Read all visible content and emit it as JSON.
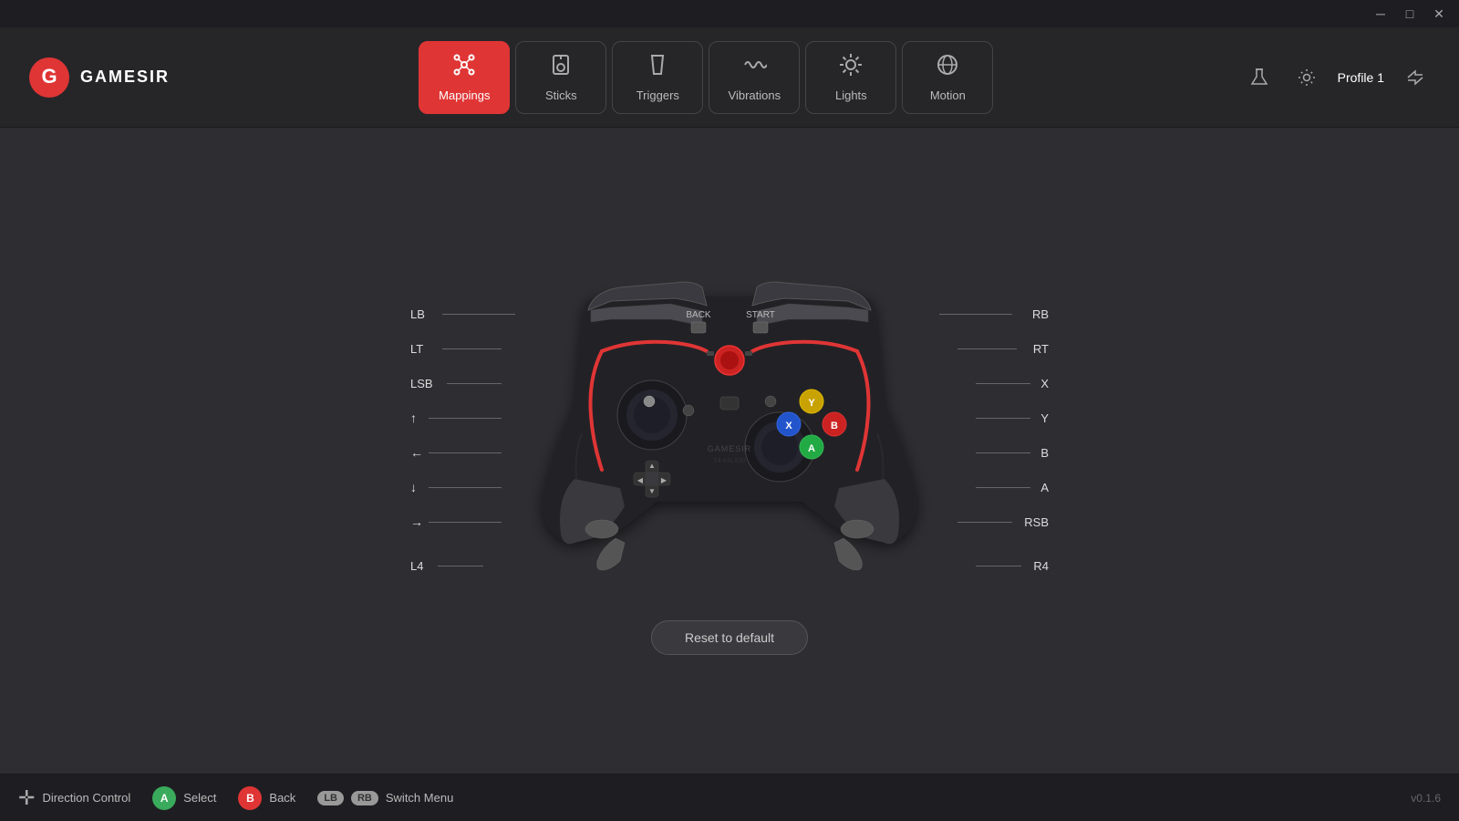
{
  "app": {
    "title": "GameSir",
    "logo_text": "GAMESIR"
  },
  "titlebar": {
    "minimize": "─",
    "maximize": "□",
    "close": "✕"
  },
  "nav": {
    "tabs": [
      {
        "id": "mappings",
        "label": "Mappings",
        "icon": "⊕",
        "active": true
      },
      {
        "id": "sticks",
        "label": "Sticks",
        "icon": "◎",
        "active": false
      },
      {
        "id": "triggers",
        "label": "Triggers",
        "icon": "⌐",
        "active": false
      },
      {
        "id": "vibrations",
        "label": "Vibrations",
        "icon": "〜",
        "active": false
      },
      {
        "id": "lights",
        "label": "Lights",
        "icon": "✦",
        "active": false
      },
      {
        "id": "motion",
        "label": "Motion",
        "icon": "⟳",
        "active": false
      }
    ]
  },
  "header_right": {
    "profile_label": "Profile 1"
  },
  "controller": {
    "labels_left": [
      "LB",
      "LT",
      "LSB",
      "↑",
      "←",
      "↓",
      "→",
      "L4"
    ],
    "labels_right": [
      "RB",
      "RT",
      "X",
      "Y",
      "B",
      "A",
      "RSB",
      "R4"
    ],
    "labels_top": [
      "BACK",
      "START"
    ]
  },
  "buttons": {
    "reset": "Reset to default"
  },
  "bottom_bar": {
    "direction_control": "Direction Control",
    "select": "Select",
    "back": "Back",
    "switch_menu": "Switch Menu",
    "version": "v0.1.6"
  }
}
